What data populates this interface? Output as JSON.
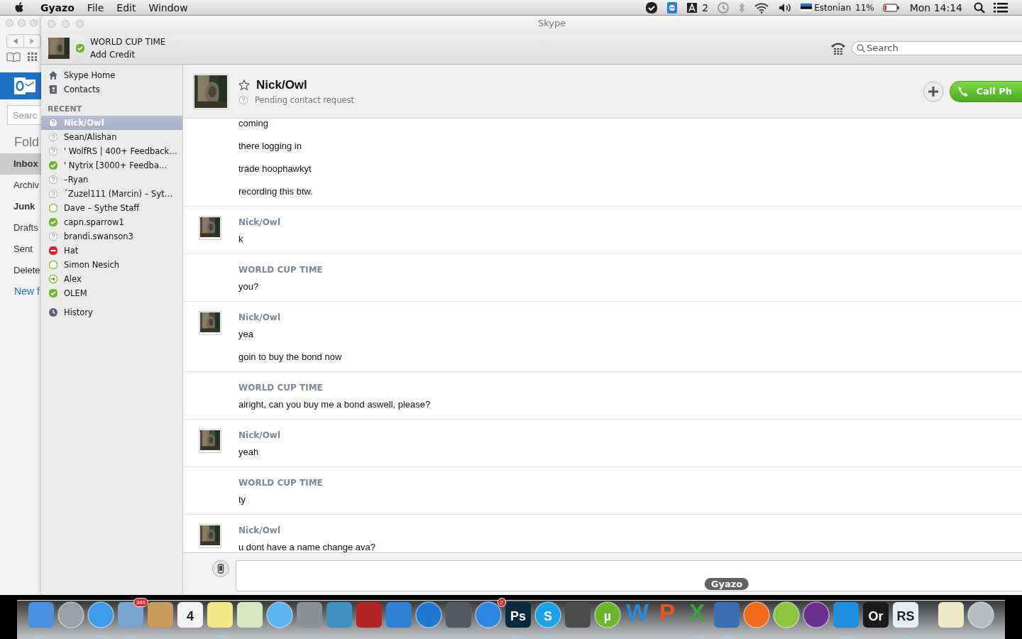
{
  "menu_bar": {
    "app": "Gyazo",
    "menus": [
      "File",
      "Edit",
      "Window"
    ],
    "status_count": "2",
    "input_source": "Estonian",
    "battery": "11%",
    "clock": "Mon 14:14"
  },
  "background_window": {
    "search_placeholder": "Searc",
    "heading": "Fold",
    "folders": [
      {
        "label": "Inbox",
        "selected": true,
        "unread": true
      },
      {
        "label": "Archiv",
        "selected": false,
        "unread": false
      },
      {
        "label": "Junk",
        "selected": false,
        "unread": true
      },
      {
        "label": "Drafts",
        "selected": false,
        "unread": false
      },
      {
        "label": "Sent",
        "selected": false,
        "unread": false
      },
      {
        "label": "Delete",
        "selected": false,
        "unread": false
      }
    ],
    "new_folder": "New f"
  },
  "window": {
    "title": "Skype"
  },
  "account": {
    "name": "WORLD CUP TIME",
    "kind": "online",
    "link": "Add Credit"
  },
  "search": {
    "placeholder": "Search"
  },
  "sidebar": {
    "items": [
      {
        "label": "Skype Home",
        "kind": "home"
      },
      {
        "label": "Contacts",
        "kind": "contacts"
      }
    ],
    "recent_heading": "RECENT",
    "recent": [
      {
        "name": "Nick/Owl",
        "kind": "pending",
        "selected": true
      },
      {
        "name": "Sean/Alishan",
        "kind": "pending",
        "selected": false
      },
      {
        "name": "' WolfRS | 400+ Feedback…",
        "kind": "pending",
        "selected": false
      },
      {
        "name": "'    Nytrix [3000+ Feedba…",
        "kind": "online",
        "selected": false
      },
      {
        "name": "–Ryan",
        "kind": "pending",
        "selected": false
      },
      {
        "name": "´Zuzel111 (Marcin) – Syt…",
        "kind": "pending",
        "selected": false
      },
      {
        "name": "Dave – Sythe Staff",
        "kind": "offline",
        "selected": false
      },
      {
        "name": "capn.sparrow1",
        "kind": "online",
        "selected": false
      },
      {
        "name": "brandi.swanson3",
        "kind": "pending",
        "selected": false
      },
      {
        "name": "Hat",
        "kind": "busy",
        "selected": false
      },
      {
        "name": "Simon Nesich",
        "kind": "offline",
        "selected": false
      },
      {
        "name": "Alex",
        "kind": "forwarding",
        "selected": false
      },
      {
        "name": "OLEM",
        "kind": "online",
        "selected": false
      }
    ],
    "history": "History"
  },
  "conversation": {
    "name": "Nick/Owl",
    "favorite": false,
    "subtitle": "Pending contact request",
    "call_button": "Call Ph"
  },
  "messages": [
    {
      "kind": "outgoing",
      "lines": [
        "coming",
        "there logging in",
        "trade hoophawkyt",
        "recording this btw."
      ]
    },
    {
      "kind": "incoming",
      "sender": "Nick/Owl",
      "lines": [
        "k"
      ]
    },
    {
      "kind": "outgoing",
      "sender": "WORLD CUP TIME",
      "lines": [
        "you?"
      ]
    },
    {
      "kind": "incoming",
      "sender": "Nick/Owl",
      "lines": [
        "yea",
        "goin to buy the bond now"
      ]
    },
    {
      "kind": "outgoing",
      "sender": "WORLD CUP TIME",
      "lines": [
        "alright, can you buy me a bond aswell, please?"
      ]
    },
    {
      "kind": "incoming",
      "sender": "Nick/Owl",
      "lines": [
        "yeah"
      ]
    },
    {
      "kind": "outgoing",
      "sender": "WORLD CUP TIME",
      "lines": [
        "ty"
      ]
    },
    {
      "kind": "incoming",
      "sender": "Nick/Owl",
      "lines": [
        "u dont have a name change ava?"
      ]
    }
  ],
  "dock": {
    "tooltip": "Gyazo",
    "apps": [
      {
        "kind": "square",
        "color": "#4a8fe0",
        "running": true
      },
      {
        "kind": "circle",
        "color": "#9a9fa8",
        "running": false
      },
      {
        "kind": "circle",
        "color": "#3d9be9",
        "running": true
      },
      {
        "kind": "square",
        "color": "#7aa3cf",
        "badge": "346",
        "running": true
      },
      {
        "kind": "square",
        "color": "#c79a5a",
        "running": false
      },
      {
        "kind": "square",
        "color": "#f2f2f2",
        "glyph": "4",
        "running": false
      },
      {
        "kind": "square",
        "color": "#f4e68a",
        "running": true
      },
      {
        "kind": "square",
        "color": "#d9e6c4",
        "running": false
      },
      {
        "kind": "circle",
        "color": "#5bb3f0",
        "running": false
      },
      {
        "kind": "square",
        "color": "#8c9198",
        "running": false
      },
      {
        "kind": "square",
        "color": "#3f8fbf",
        "running": false
      },
      {
        "kind": "square",
        "color": "#b32525",
        "running": false
      },
      {
        "kind": "square",
        "color": "#2f7fd6",
        "running": false
      },
      {
        "kind": "circle",
        "color": "#1f77d0",
        "running": false
      },
      {
        "kind": "square",
        "color": "#55595f",
        "running": false
      },
      {
        "kind": "circle",
        "color": "#2a86e0",
        "badge": "2",
        "running": false
      },
      {
        "kind": "square",
        "color": "#0b2a3d",
        "glyph": "Ps",
        "running": true
      },
      {
        "kind": "circle",
        "color": "#1aa3e8",
        "glyph": "S",
        "running": true
      },
      {
        "kind": "square",
        "color": "#4b4b4b",
        "running": false
      },
      {
        "kind": "circle",
        "color": "#6cb52d",
        "glyph": "µ",
        "running": false
      },
      {
        "kind": "glyph",
        "color": "#2b8ad6",
        "glyph": "W",
        "running": false
      },
      {
        "kind": "glyph",
        "color": "#e8541e",
        "glyph": "P",
        "running": false
      },
      {
        "kind": "glyph",
        "color": "#3aa33a",
        "glyph": "X",
        "running": true
      },
      {
        "kind": "square",
        "color": "#3d6fb5",
        "running": true
      },
      {
        "kind": "circle",
        "color": "#f06b1c",
        "running": false
      },
      {
        "kind": "circle",
        "color": "#8cc43c",
        "running": false
      },
      {
        "kind": "circle",
        "color": "#6a2f8f",
        "running": false
      },
      {
        "kind": "square",
        "color": "#1f8ee0",
        "running": true
      },
      {
        "kind": "square",
        "color": "#1a1a1a",
        "glyph": "Or",
        "running": false
      },
      {
        "kind": "square",
        "color": "#e8edf2",
        "glyph": "RS",
        "running": true
      },
      {
        "kind": "square",
        "color": "#efe8c8",
        "running": false
      },
      {
        "kind": "circle",
        "color": "#b8bcc0",
        "running": false
      }
    ]
  }
}
